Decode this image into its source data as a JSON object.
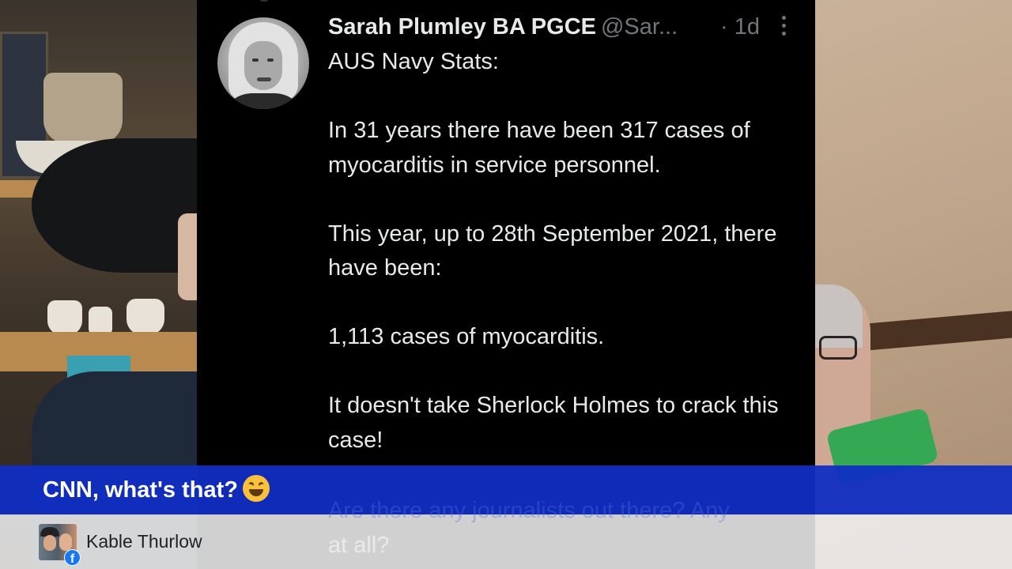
{
  "tweet": {
    "author_name": "Sarah Plumley BA PGCE",
    "handle": "@Sar...",
    "time": "· 1d",
    "paragraphs": [
      "AUS Navy Stats:",
      "In 31 years there have been 317 cases of myocarditis in service personnel.",
      "This year, up to 28th September 2021, there have been:",
      "1,113 cases of myocarditis.",
      "It doesn't take Sherlock Holmes to crack this case!"
    ],
    "hidden_paragraph_line1": "Are there any journalists out there? Any",
    "hidden_paragraph_line2": "at all?"
  },
  "overlay": {
    "comment_text": "CNN, what's that?",
    "comment_emoji": "grinning-squinting-face",
    "commenter_name": "Kable Thurlow",
    "platform_badge": "f",
    "banner_color": "#102ec4"
  },
  "icons": {
    "more": "more-vertical-icon",
    "platform": "facebook-icon"
  }
}
